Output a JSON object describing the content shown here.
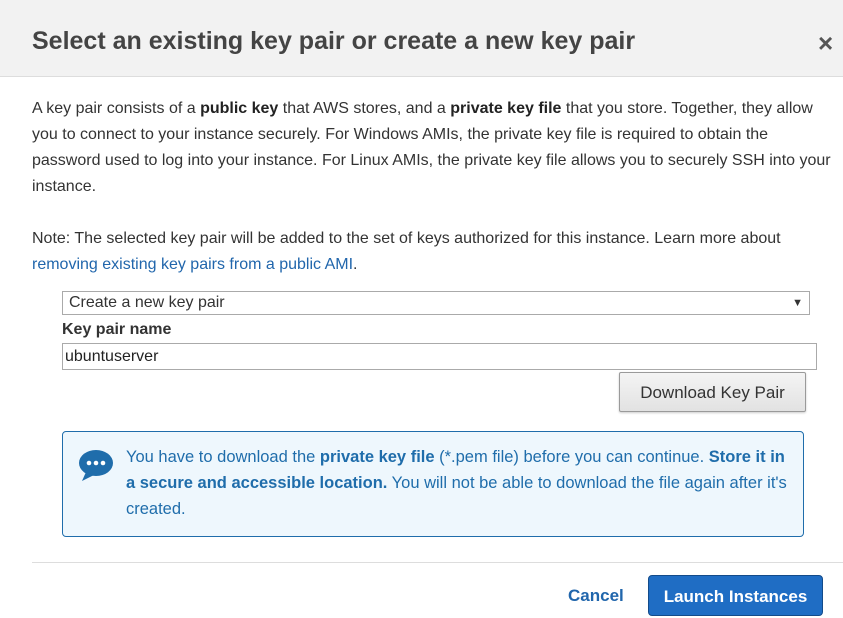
{
  "dialog": {
    "title": "Select an existing key pair or create a new key pair",
    "close_glyph": "×",
    "para1": {
      "t1": "A key pair consists of a ",
      "b1": "public key",
      "t2": " that AWS stores, and a ",
      "b2": "private key file",
      "t3": " that you store. Together, they allow you to connect to your instance securely. For Windows AMIs, the private key file is required to obtain the password used to log into your instance. For Linux AMIs, the private key file allows you to securely SSH into your instance."
    },
    "para2": {
      "t1": "Note: The selected key pair will be added to the set of keys authorized for this instance. Learn more about ",
      "link": "removing existing key pairs from a public AMI",
      "t2": "."
    }
  },
  "form": {
    "select_value": "Create a new key pair",
    "select_arrow": "▼",
    "key_name_label": "Key pair name",
    "key_name_value": "ubuntuserver",
    "download_button": "Download Key Pair"
  },
  "info": {
    "icon": "chat-bubble-icon",
    "t1": "You have to download the ",
    "b1": "private key file",
    "t2": " (*.pem file) before you can continue. ",
    "b2": "Store it in a secure and accessible location.",
    "t3": " You will not be able to download the file again after it's created."
  },
  "footer": {
    "cancel": "Cancel",
    "launch": "Launch Instances"
  },
  "colors": {
    "header_bg": "#f2f2f2",
    "link": "#2166ac",
    "info_border": "#1f6dab",
    "info_bg": "#eef7fd",
    "primary_button": "#1f6dc4"
  }
}
